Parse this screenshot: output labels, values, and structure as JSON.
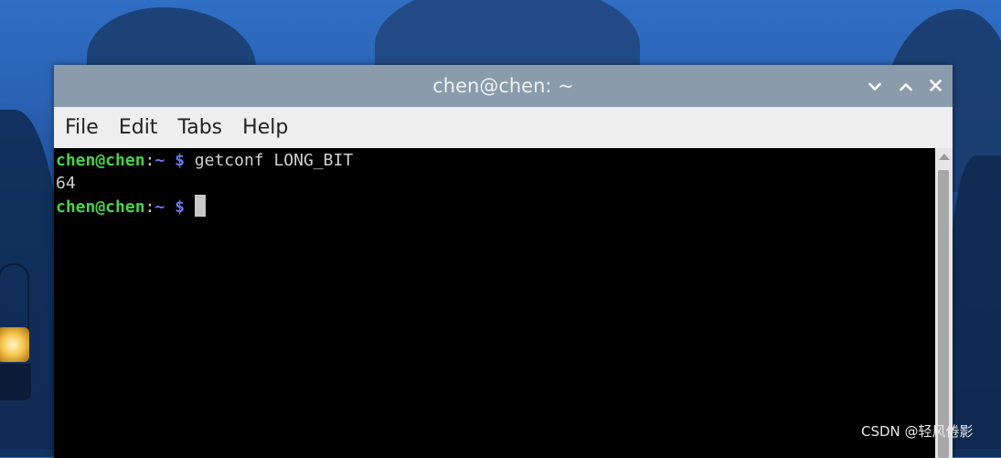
{
  "window": {
    "title": "chen@chen: ~",
    "controls": {
      "minimize_icon": "chevron-down-icon",
      "maximize_icon": "chevron-up-icon",
      "close_icon": "close-icon"
    }
  },
  "menu": {
    "items": [
      {
        "label": "File"
      },
      {
        "label": "Edit"
      },
      {
        "label": "Tabs"
      },
      {
        "label": "Help"
      }
    ]
  },
  "terminal": {
    "lines": [
      {
        "user": "chen@chen",
        "colon": ":",
        "path": "~",
        "dollar": "$",
        "command": "getconf LONG_BIT"
      },
      {
        "output": "64"
      },
      {
        "user": "chen@chen",
        "colon": ":",
        "path": "~",
        "dollar": "$",
        "command": ""
      }
    ],
    "colors": {
      "user": "#46d24a",
      "path": "#6a76f0",
      "text": "#d0d0d0",
      "background": "#000000"
    }
  },
  "watermark": "CSDN @轻风倦影"
}
